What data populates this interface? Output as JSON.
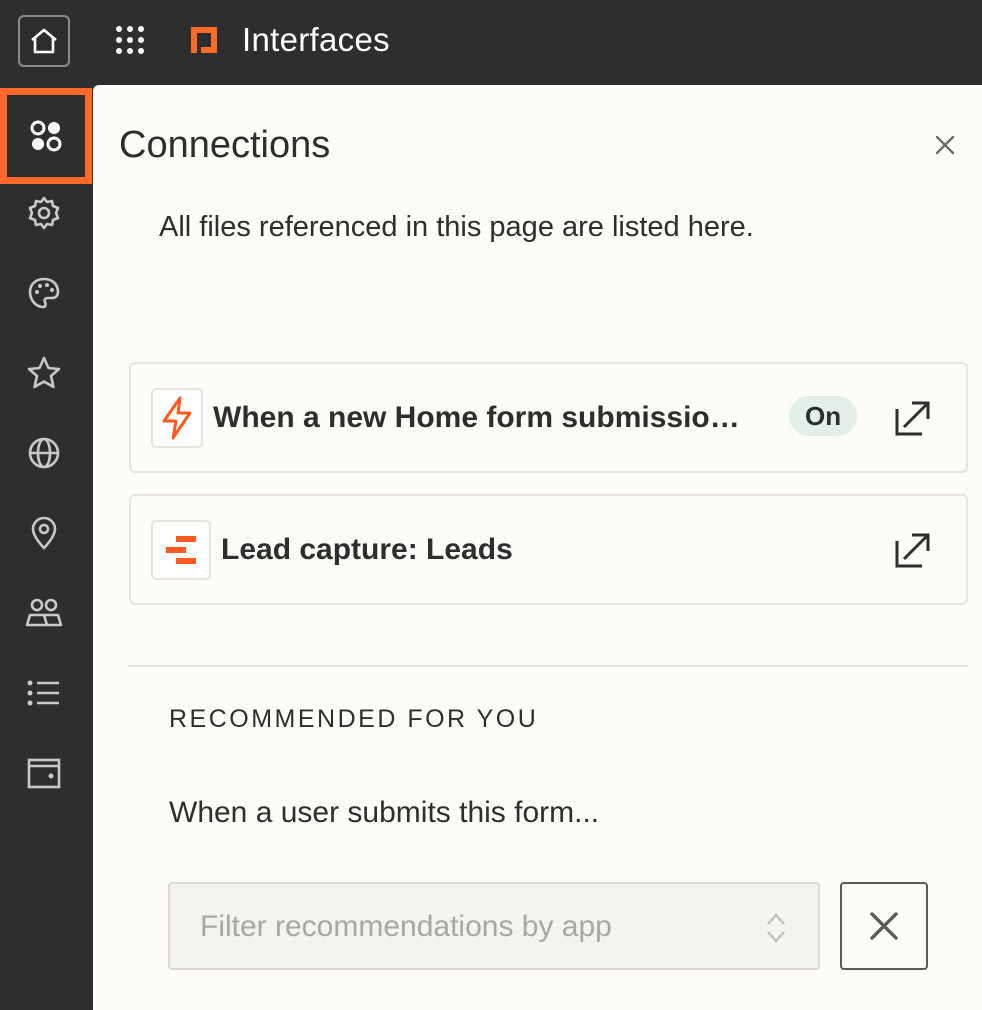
{
  "header": {
    "title": "Interfaces",
    "brand_color": "#ff6a2b"
  },
  "sidebar": {
    "items": [
      {
        "icon": "connections-icon",
        "active": true
      },
      {
        "icon": "gear-icon"
      },
      {
        "icon": "palette-icon"
      },
      {
        "icon": "star-icon"
      },
      {
        "icon": "globe-icon"
      },
      {
        "icon": "location-pin-icon"
      },
      {
        "icon": "users-icon"
      },
      {
        "icon": "list-icon"
      },
      {
        "icon": "wallet-icon"
      }
    ]
  },
  "panel": {
    "title": "Connections",
    "description": "All files referenced in this page are listed here.",
    "connections": [
      {
        "label": "When a new Home form submissio…",
        "status": "On",
        "icon": "zap-icon"
      },
      {
        "label": "Lead capture: Leads",
        "icon": "table-icon"
      }
    ],
    "recommended": {
      "heading": "RECOMMENDED FOR YOU",
      "trigger": "When a user submits this form...",
      "filter_placeholder": "Filter recommendations by app"
    }
  }
}
